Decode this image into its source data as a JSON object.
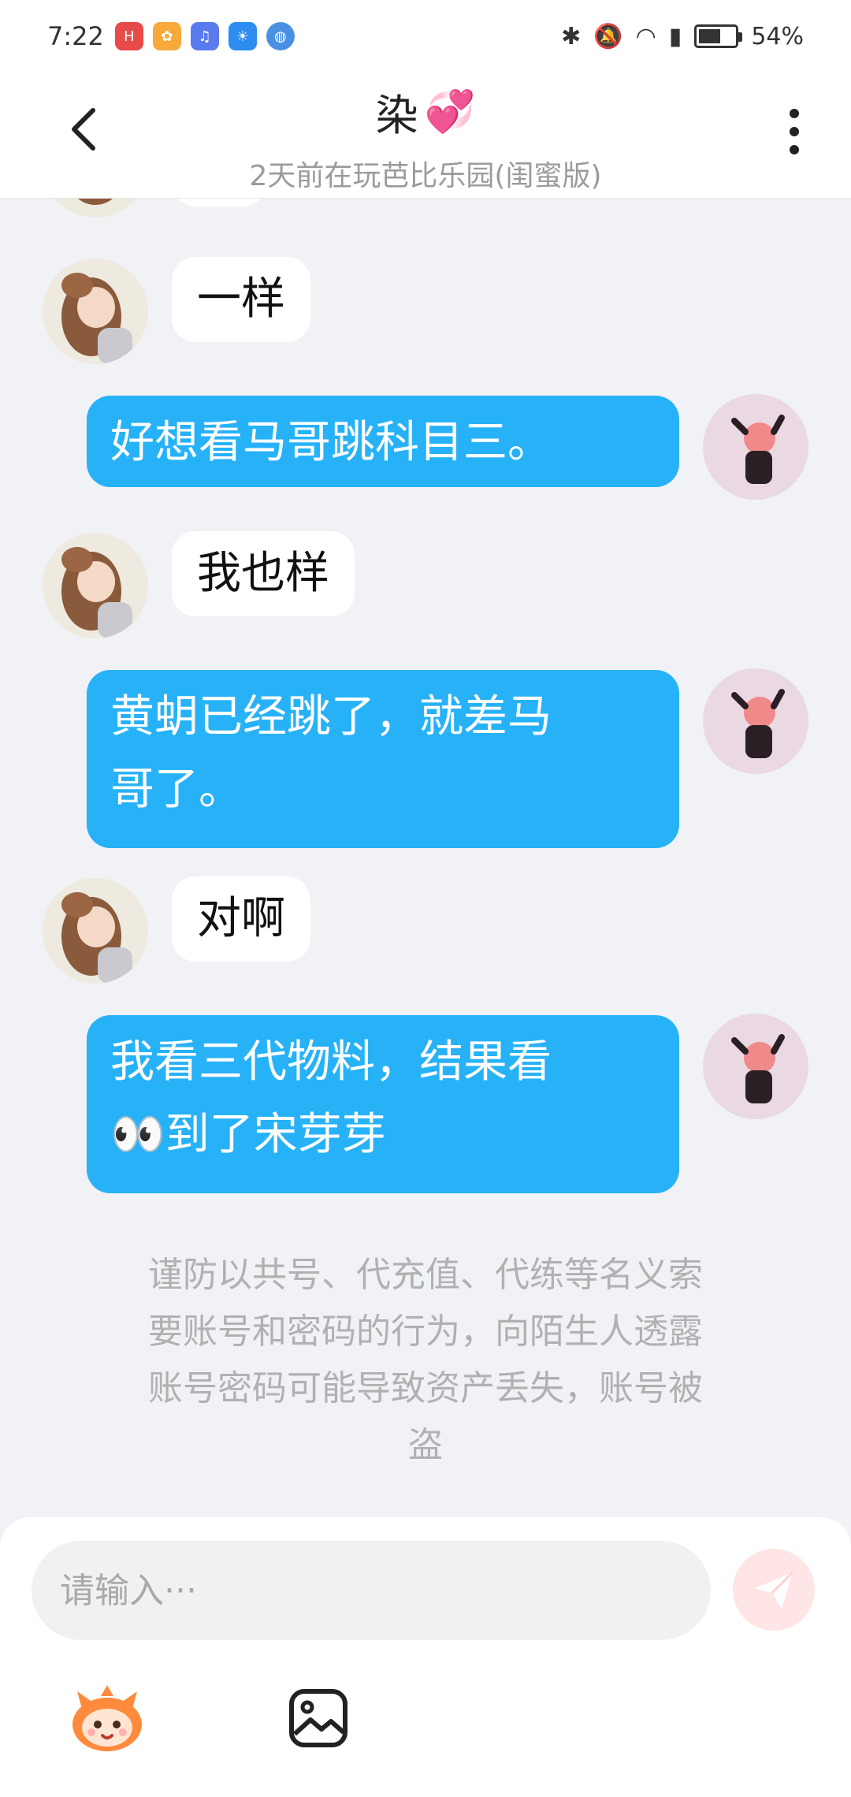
{
  "status_bar": {
    "time": "7:22",
    "battery": "54%",
    "app_icons": [
      "huawei-app-icon",
      "photo-app-icon",
      "music-app-icon",
      "weather-app-icon",
      "browser-app-icon"
    ]
  },
  "header": {
    "title": "染",
    "title_emoji": "💞",
    "subtitle": "2天前在玩芭比乐园(闺蜜版)"
  },
  "messages": [
    {
      "side": "left",
      "text": "一样"
    },
    {
      "side": "right",
      "text": "好想看马哥跳科目三。"
    },
    {
      "side": "left",
      "text": "我也样"
    },
    {
      "side": "right",
      "text_line1": "黄蚏已经跳了，就差马",
      "text_line2": "哥了。"
    },
    {
      "side": "left",
      "text": "对啊"
    },
    {
      "side": "right",
      "text_line1": "我看三代物料，结果看",
      "text_line2": "👀到了宋芽芽"
    }
  ],
  "notice": {
    "line1": "谨防以共号、代充值、代练等名义索",
    "line2": "要账号和密码的行为，向陌生人透露",
    "line3": "账号密码可能导致资产丢失，账号被",
    "line4": "盗"
  },
  "composer": {
    "placeholder": "请输入···"
  },
  "colors": {
    "outgoing_bubble": "#27b2f8",
    "incoming_bubble": "#ffffff",
    "background": "#f0f2f6",
    "send_button": "#ffe5e5"
  }
}
